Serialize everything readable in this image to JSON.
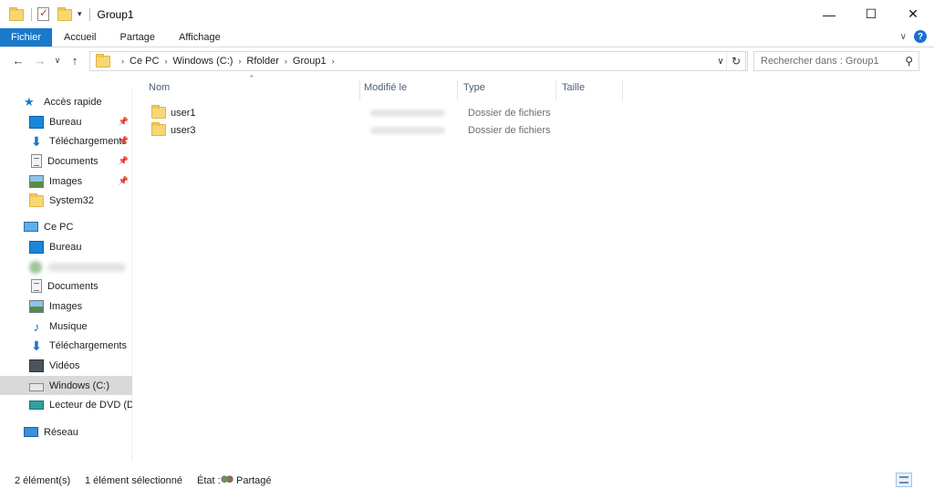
{
  "window": {
    "title": "Group1",
    "controls": {
      "minimize": "—",
      "maximize": "☐",
      "close": "✕"
    }
  },
  "ribbon": {
    "tabs": [
      "Fichier",
      "Accueil",
      "Partage",
      "Affichage"
    ],
    "help_label": "?"
  },
  "address": {
    "breadcrumbs": [
      "Ce PC",
      "Windows (C:)",
      "Rfolder",
      "Group1"
    ]
  },
  "search": {
    "placeholder": "Rechercher dans : Group1"
  },
  "sidebar": {
    "quick_access": {
      "label": "Accès rapide",
      "items": [
        {
          "label": "Bureau",
          "icon": "desktop-icon",
          "pinned": true
        },
        {
          "label": "Téléchargements",
          "icon": "download-icon",
          "pinned": true
        },
        {
          "label": "Documents",
          "icon": "documents-icon",
          "pinned": true
        },
        {
          "label": "Images",
          "icon": "pictures-icon",
          "pinned": true
        },
        {
          "label": "System32",
          "icon": "folder-icon",
          "pinned": false
        }
      ]
    },
    "this_pc": {
      "label": "Ce PC",
      "items": [
        {
          "label": "Bureau",
          "icon": "desktop-icon"
        },
        {
          "label": "",
          "icon": "redacted-icon",
          "redacted": true
        },
        {
          "label": "Documents",
          "icon": "documents-icon"
        },
        {
          "label": "Images",
          "icon": "pictures-icon"
        },
        {
          "label": "Musique",
          "icon": "music-icon"
        },
        {
          "label": "Téléchargements",
          "icon": "download-icon"
        },
        {
          "label": "Vidéos",
          "icon": "videos-icon"
        },
        {
          "label": "Windows (C:)",
          "icon": "drive-icon",
          "selected": true
        },
        {
          "label": "Lecteur de DVD (D:)",
          "icon": "dvd-drive-icon"
        }
      ]
    },
    "network": {
      "label": "Réseau"
    }
  },
  "file_list": {
    "columns": [
      "Nom",
      "Modifié le",
      "Type",
      "Taille"
    ],
    "rows": [
      {
        "name": "user1",
        "modified": "",
        "type": "Dossier de fichiers",
        "size": ""
      },
      {
        "name": "user3",
        "modified": "",
        "type": "Dossier de fichiers",
        "size": ""
      }
    ]
  },
  "status": {
    "count": "2 élément(s)",
    "selection": "1 élément sélectionné",
    "state_label": "État :",
    "state_value": "Partagé"
  },
  "colors": {
    "accent": "#1979ca",
    "selected_bg": "#d9d9d9"
  }
}
